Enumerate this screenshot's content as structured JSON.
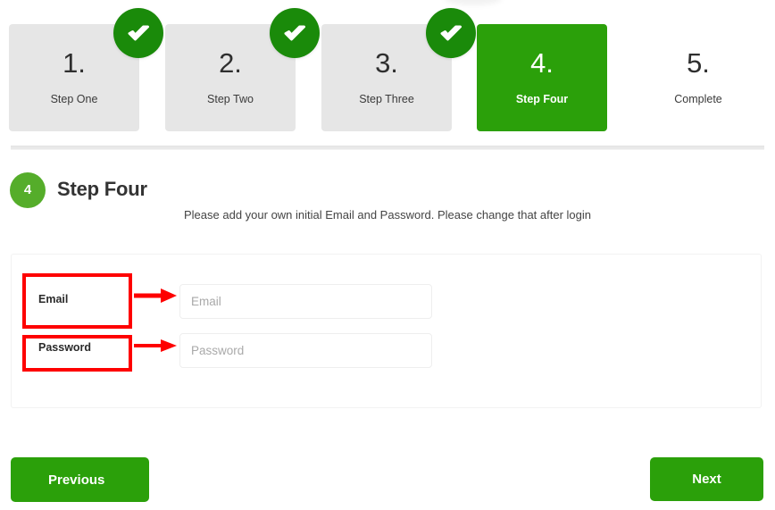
{
  "colors": {
    "accent_green": "#2ba00a",
    "check_green": "#1a8a0a",
    "badge_green": "#55ad2a",
    "step_inactive_bg": "#e6e6e6",
    "annotation_red": "#fe0000",
    "divider": "#e9e9e9",
    "input_border": "#eeeeee",
    "placeholder_text": "#a9a9a9"
  },
  "stepper": {
    "steps": [
      {
        "number": "1.",
        "label": "Step One",
        "state": "completed",
        "icon": "check-icon"
      },
      {
        "number": "2.",
        "label": "Step Two",
        "state": "completed",
        "icon": "check-icon"
      },
      {
        "number": "3.",
        "label": "Step Three",
        "state": "completed",
        "icon": "check-icon"
      },
      {
        "number": "4.",
        "label": "Step Four",
        "state": "active",
        "icon": ""
      },
      {
        "number": "5.",
        "label": "Complete",
        "state": "upcoming",
        "icon": ""
      }
    ]
  },
  "section": {
    "badge_number": "4",
    "title": "Step Four",
    "description": "Please add your own initial Email and Password. Please change that after login"
  },
  "form": {
    "fields": [
      {
        "label": "Email",
        "value": "",
        "placeholder": "Email"
      },
      {
        "label": "Password",
        "value": "",
        "placeholder": "Password"
      }
    ]
  },
  "annotations": {
    "email_box_target": "Email",
    "password_box_target": "Password",
    "arrow_icon": "arrow-right-icon"
  },
  "footer": {
    "previous_label": "Previous",
    "next_label": "Next"
  }
}
